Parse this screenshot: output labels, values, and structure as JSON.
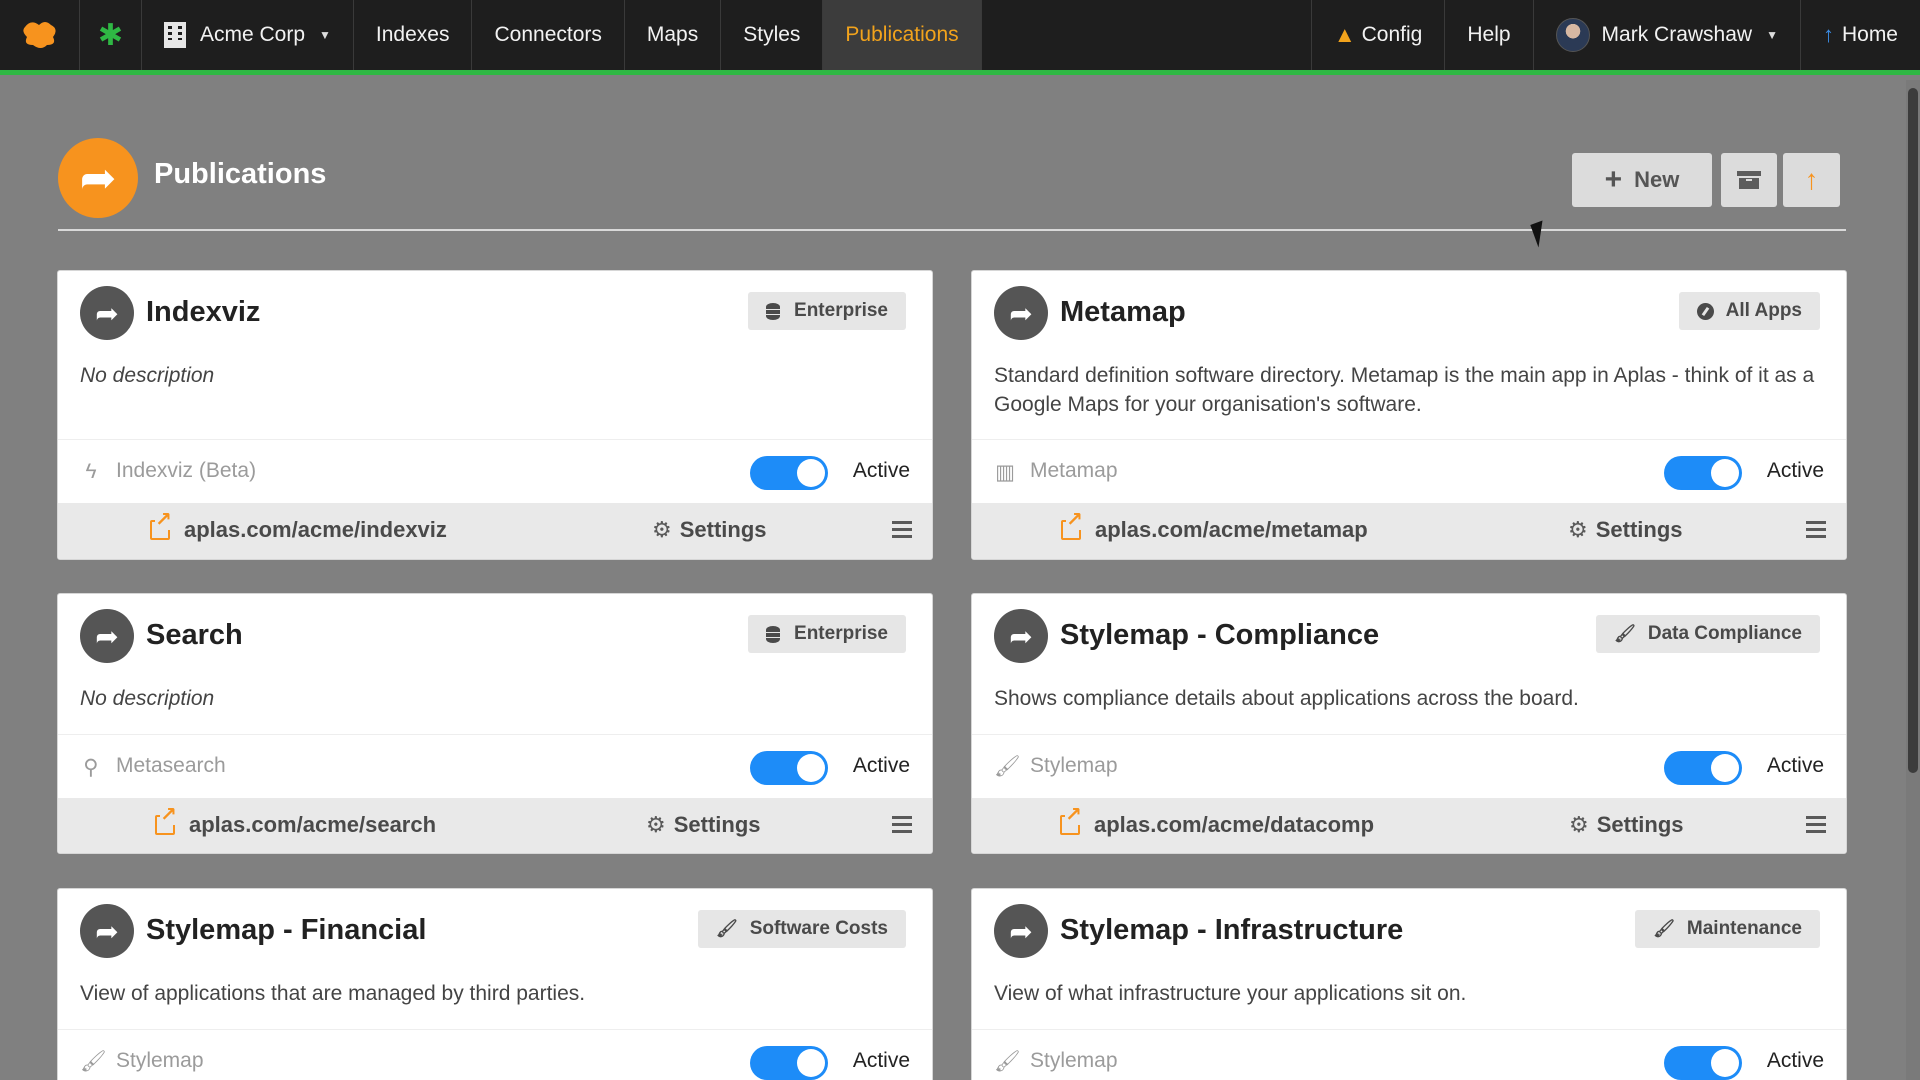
{
  "nav": {
    "org": "Acme Corp",
    "items": [
      "Indexes",
      "Connectors",
      "Maps",
      "Styles",
      "Publications"
    ],
    "config": "Config",
    "help": "Help",
    "user": "Mark Crawshaw",
    "home": "Home"
  },
  "page": {
    "title": "Publications",
    "new_label": "New"
  },
  "cards": [
    {
      "title": "Indexviz",
      "badge": "Enterprise",
      "badge_icon": "database-icon",
      "desc": "No description",
      "source_icon": "bolt-icon",
      "source": "Indexviz (Beta)",
      "status": "Active",
      "link": "aplas.com/acme/indexviz",
      "settings": "Settings"
    },
    {
      "title": "Metamap",
      "badge": "All Apps",
      "badge_icon": "compass-icon",
      "desc": "Standard definition software directory. Metamap is the main app in Aplas - think of it as a Google Maps for your organisation's software.",
      "source_icon": "map-icon",
      "source": "Metamap",
      "status": "Active",
      "link": "aplas.com/acme/metamap",
      "settings": "Settings"
    },
    {
      "title": "Search",
      "badge": "Enterprise",
      "badge_icon": "database-icon",
      "desc": "No description",
      "source_icon": "search-icon",
      "source": "Metasearch",
      "status": "Active",
      "link": "aplas.com/acme/search",
      "settings": "Settings"
    },
    {
      "title": "Stylemap - Compliance",
      "badge": "Data Compliance",
      "badge_icon": "brush-icon",
      "desc": "Shows compliance details about applications across the board.",
      "source_icon": "brush-icon",
      "source": "Stylemap",
      "status": "Active",
      "link": "aplas.com/acme/datacomp",
      "settings": "Settings"
    },
    {
      "title": "Stylemap - Financial",
      "badge": "Software Costs",
      "badge_icon": "brush-icon",
      "desc": "View of applications that are managed by third parties.",
      "source_icon": "brush-icon",
      "source": "Stylemap",
      "status": "Active"
    },
    {
      "title": "Stylemap - Infrastructure",
      "badge": "Maintenance",
      "badge_icon": "brush-icon",
      "desc": "View of what infrastructure your applications sit on.",
      "source_icon": "brush-icon",
      "source": "Stylemap",
      "status": "Active"
    }
  ],
  "colors": {
    "accent": "#f7931e",
    "nav_bg": "#1e1e1e",
    "nav_border": "#2fb844",
    "toggle": "#1d8cf8",
    "page_bg": "#808080"
  }
}
